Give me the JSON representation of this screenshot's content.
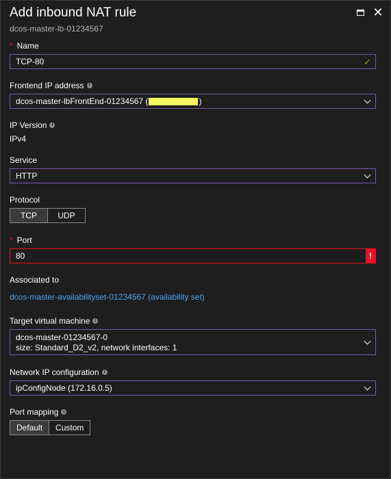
{
  "header": {
    "title": "Add inbound NAT rule",
    "subtitle": "dcos-master-lb-01234567"
  },
  "name_field": {
    "label": "Name",
    "value": "TCP-80"
  },
  "frontend_ip": {
    "label": "Frontend IP address",
    "value_prefix": "dcos-master-lbFrontEnd-01234567 (",
    "value_suffix": ")"
  },
  "ip_version": {
    "label": "IP Version",
    "value": "IPv4"
  },
  "service": {
    "label": "Service",
    "value": "HTTP"
  },
  "protocol": {
    "label": "Protocol",
    "options": [
      "TCP",
      "UDP"
    ],
    "selected": "TCP"
  },
  "port": {
    "label": "Port",
    "value": "80",
    "error_mark": "!"
  },
  "associated": {
    "label": "Associated to",
    "link": "dcos-master-availabilityset-01234567 (availability set)"
  },
  "target_vm": {
    "label": "Target virtual machine",
    "line1": "dcos-master-01234567-0",
    "line2": "size: Standard_D2_v2, network interfaces: 1"
  },
  "network_ip": {
    "label": "Network IP configuration",
    "value": "ipConfigNode (172.16.0.5)"
  },
  "port_mapping": {
    "label": "Port mapping",
    "options": [
      "Default",
      "Custom"
    ],
    "selected": "Default"
  },
  "colors": {
    "accent_border": "#7b5aa6",
    "error": "#e81123",
    "link": "#4aa3f0",
    "valid": "#7fba00"
  }
}
